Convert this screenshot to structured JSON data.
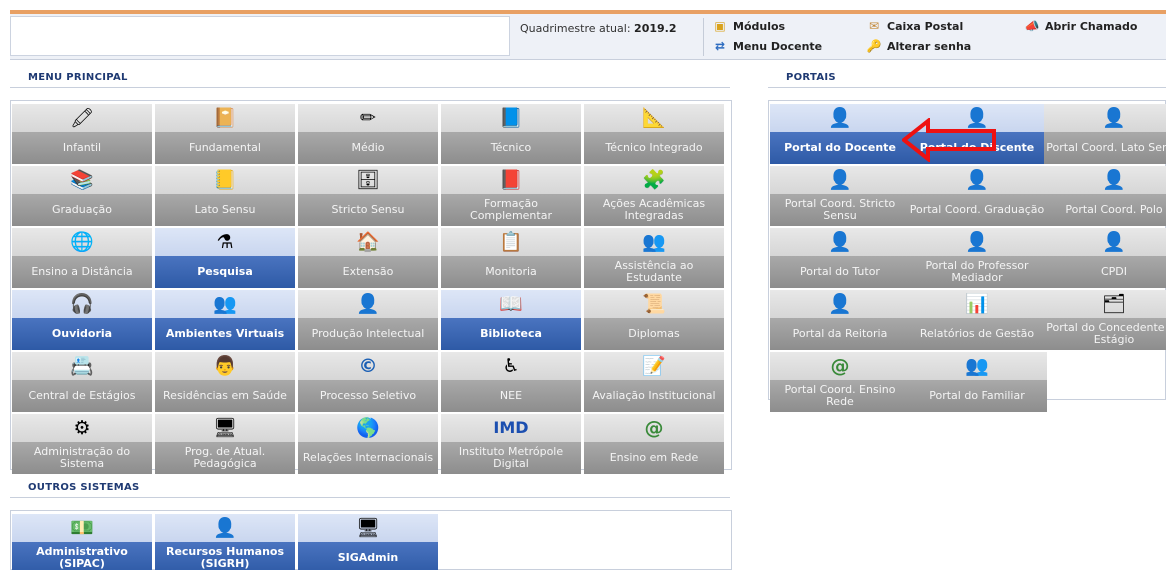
{
  "header": {
    "quadrimestre_label": "Quadrimestre atual:",
    "quadrimestre_value": "2019.2",
    "links": {
      "modulos": "Módulos",
      "caixa_postal": "Caixa Postal",
      "abrir_chamado": "Abrir Chamado",
      "menu_docente": "Menu Docente",
      "alterar_senha": "Alterar senha"
    },
    "icons": {
      "modulos": "cube-icon",
      "caixa_postal": "mailbox-icon",
      "abrir_chamado": "horn-icon",
      "menu_docente": "menu-arrows-icon",
      "alterar_senha": "key-person-icon"
    }
  },
  "menu_principal": {
    "title": "Menu Principal",
    "tiles": [
      {
        "label": "Infantil",
        "icon": "🖍",
        "active": false
      },
      {
        "label": "Fundamental",
        "icon": "📔",
        "active": false
      },
      {
        "label": "Médio",
        "icon": "✏",
        "active": false
      },
      {
        "label": "Técnico",
        "icon": "📘",
        "active": false
      },
      {
        "label": "Técnico Integrado",
        "icon": "📐",
        "active": false
      },
      {
        "label": "Graduação",
        "icon": "📚",
        "active": false
      },
      {
        "label": "Lato Sensu",
        "icon": "📒",
        "active": false
      },
      {
        "label": "Stricto Sensu",
        "icon": "🗄",
        "active": false
      },
      {
        "label": "Formação Complementar",
        "icon": "📕",
        "active": false
      },
      {
        "label": "Ações Acadêmicas Integradas",
        "icon": "🧩",
        "active": false
      },
      {
        "label": "Ensino a Distância",
        "icon": "🌐",
        "active": false
      },
      {
        "label": "Pesquisa",
        "icon": "⚗",
        "active": true
      },
      {
        "label": "Extensão",
        "icon": "🏠",
        "active": false
      },
      {
        "label": "Monitoria",
        "icon": "📋",
        "active": false
      },
      {
        "label": "Assistência ao Estudante",
        "icon": "👥",
        "active": false
      },
      {
        "label": "Ouvidoria",
        "icon": "🎧",
        "active": true
      },
      {
        "label": "Ambientes Virtuais",
        "icon": "👥",
        "active": true
      },
      {
        "label": "Produção Intelectual",
        "icon": "👤",
        "active": false
      },
      {
        "label": "Biblioteca",
        "icon": "📖",
        "active": true
      },
      {
        "label": "Diplomas",
        "icon": "📜",
        "active": false
      },
      {
        "label": "Central de Estágios",
        "icon": "📇",
        "active": false
      },
      {
        "label": "Residências em Saúde",
        "icon": "👨",
        "active": false
      },
      {
        "label": "Processo Seletivo",
        "icon": "©",
        "active": false
      },
      {
        "label": "NEE",
        "icon": "♿",
        "active": false
      },
      {
        "label": "Avaliação Institucional",
        "icon": "📝",
        "active": false
      },
      {
        "label": "Administração do Sistema",
        "icon": "⚙",
        "active": false
      },
      {
        "label": "Prog. de Atual. Pedagógica",
        "icon": "🖥",
        "active": false
      },
      {
        "label": "Relações Internacionais",
        "icon": "🌎",
        "active": false
      },
      {
        "label": "Instituto Metrópole Digital",
        "icon": "IMD",
        "active": false
      },
      {
        "label": "Ensino em Rede",
        "icon": "@",
        "active": false
      }
    ]
  },
  "outros_sistemas": {
    "title": "Outros Sistemas",
    "tiles": [
      {
        "label": "Administrativo (SIPAC)",
        "icon": "💵",
        "active": true
      },
      {
        "label": "Recursos Humanos (SIGRH)",
        "icon": "👤",
        "active": true
      },
      {
        "label": "SIGAdmin",
        "icon": "🖥",
        "active": true
      }
    ]
  },
  "portais": {
    "title": "Portais",
    "tiles": [
      {
        "label": "Portal do Docente",
        "icon": "👤",
        "active": true
      },
      {
        "label": "Portal do Discente",
        "icon": "👤",
        "active": true
      },
      {
        "label": "Portal Coord. Lato Sensu",
        "icon": "👤",
        "active": false
      },
      {
        "label": "Portal Coord. Stricto Sensu",
        "icon": "👤",
        "active": false
      },
      {
        "label": "Portal Coord. Graduação",
        "icon": "👤",
        "active": false
      },
      {
        "label": "Portal Coord. Polo",
        "icon": "👤",
        "active": false
      },
      {
        "label": "Portal do Tutor",
        "icon": "👤",
        "active": false
      },
      {
        "label": "Portal do Professor Mediador",
        "icon": "👤",
        "active": false
      },
      {
        "label": "CPDI",
        "icon": "👤",
        "active": false
      },
      {
        "label": "Portal da Reitoria",
        "icon": "👤",
        "active": false
      },
      {
        "label": "Relatórios de Gestão",
        "icon": "📊",
        "active": false
      },
      {
        "label": "Portal do Concedente de Estágio",
        "icon": "🗂",
        "active": false
      },
      {
        "label": "Portal Coord. Ensino Rede",
        "icon": "@",
        "active": false
      },
      {
        "label": "Portal do Familiar",
        "icon": "👥",
        "active": false
      }
    ]
  },
  "annotation": {
    "type": "red-arrow",
    "points_to": "Portal do Docente"
  }
}
